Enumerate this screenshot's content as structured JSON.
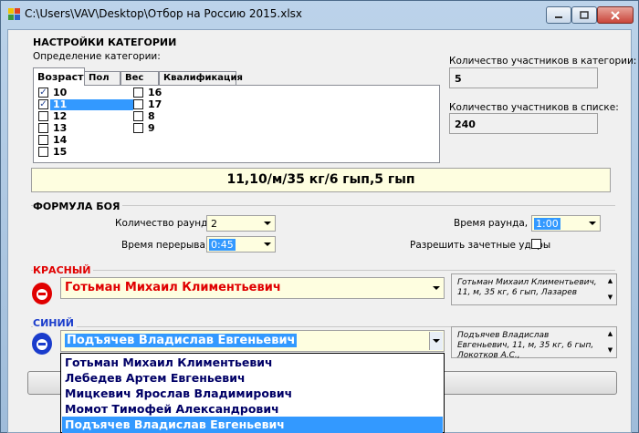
{
  "window": {
    "title": "C:\\Users\\VAV\\Desktop\\Отбор на Россию 2015.xlsx"
  },
  "category": {
    "header": "НАСТРОЙКИ КАТЕГОРИИ",
    "definition_label": "Определение категории:",
    "tabs": [
      "Возраст",
      "Пол",
      "Вес",
      "Квалификация"
    ],
    "active_tab": "Возраст",
    "ages_col1": [
      {
        "label": "10",
        "checked": true
      },
      {
        "label": "11",
        "checked": true
      },
      {
        "label": "12",
        "checked": false
      },
      {
        "label": "13",
        "checked": false
      },
      {
        "label": "14",
        "checked": false
      },
      {
        "label": "15",
        "checked": false
      }
    ],
    "ages_col2": [
      {
        "label": "16",
        "checked": false
      },
      {
        "label": "17",
        "checked": false
      },
      {
        "label": "8",
        "checked": false
      },
      {
        "label": "9",
        "checked": false
      }
    ],
    "count_in_category_label": "Количество участников в категории:",
    "count_in_category": "5",
    "count_in_list_label": "Количество участников в списке:",
    "count_in_list": "240",
    "summary": "11,10/м/35 кг/6 гып,5 гып"
  },
  "formula": {
    "header": "ФОРМУЛА БОЯ",
    "rounds_label": "Количество раундов:",
    "rounds": "2",
    "round_time_label": "Время раунда, с:",
    "round_time": "1:00",
    "break_label": "Время перерыва, с:",
    "break_time": "0:45",
    "allow_scoring_label": "Разрешить зачетные удары",
    "allow_scoring": false
  },
  "red": {
    "header": "КРАСНЫЙ",
    "color": "#e00000",
    "fighter": "Готьман Михаил Климентьевич",
    "info": "Готьман Михаил Климентьевич, 11, м, 35 кг, 6 гып, Лазарев"
  },
  "blue": {
    "header": "СИНИЙ",
    "color": "#1a3ccc",
    "fighter": "Подъячев Владислав Евгеньевич",
    "info": "Подъячев Владислав Евгеньевич, 11, м, 35 кг, 6 гып, Локотков А.С.,",
    "options": [
      "Готьман Михаил Климентьевич",
      "Лебедев Артем Евгеньевич",
      "Мицкевич Ярослав Владимирович",
      "Момот Тимофей Александрович",
      "Подъячев Владислав Евгеньевич"
    ]
  }
}
